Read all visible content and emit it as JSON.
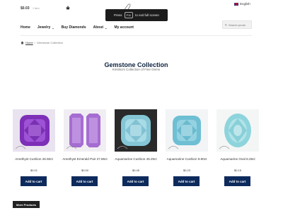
{
  "header": {
    "cart_amount": "$0.03",
    "cart_items": "1 item",
    "cart_icon": "basket-icon",
    "logo_icon": "script-logo-mark",
    "fullscreen_toast": {
      "prefix": "Press",
      "key": "F11",
      "suffix": "to exit full screen"
    },
    "language": {
      "flag_icon": "uk-flag-icon",
      "label": "English"
    }
  },
  "nav": {
    "items": [
      {
        "label": "Home",
        "has_dropdown": false
      },
      {
        "label": "Jewelry",
        "has_dropdown": true
      },
      {
        "label": "Buy Diamonds",
        "has_dropdown": false
      },
      {
        "label": "About",
        "has_dropdown": true
      },
      {
        "label": "My account",
        "has_dropdown": false
      }
    ],
    "caret": "⌄"
  },
  "search": {
    "placeholder": "Search produ",
    "icon": "search-icon"
  },
  "breadcrumb": {
    "home": "Home",
    "separator": "/",
    "current": "Gemstone Collection"
  },
  "page": {
    "title": "Gemstone Collection",
    "subtitle": "Kristina's Collection of Fine Gems"
  },
  "products": [
    {
      "name": "Amethyst Cushion 26.50ct",
      "price": "$0.01",
      "button": "Add to cart",
      "color": "#8b3fc0"
    },
    {
      "name": "Amethyst Emerald Pair 27.86ct",
      "price": "$0.00",
      "button": "Add to cart",
      "color": "#b07fd6"
    },
    {
      "name": "Aquamarine Cushion 49.25ct",
      "price": "$0.45",
      "button": "Add to cart",
      "color": "#8fd0df"
    },
    {
      "name": "Aquamarine Cushion 9.80ct",
      "price": "$0.23",
      "button": "Add to cart",
      "color": "#7cc9dc"
    },
    {
      "name": "Aquamarine Oval 8.25ct",
      "price": "$0.15",
      "button": "Add to cart",
      "color": "#9fdbe0"
    }
  ],
  "more_products": "More Products",
  "colors": {
    "navy": "#0d2a5c",
    "title": "#0d2240"
  }
}
